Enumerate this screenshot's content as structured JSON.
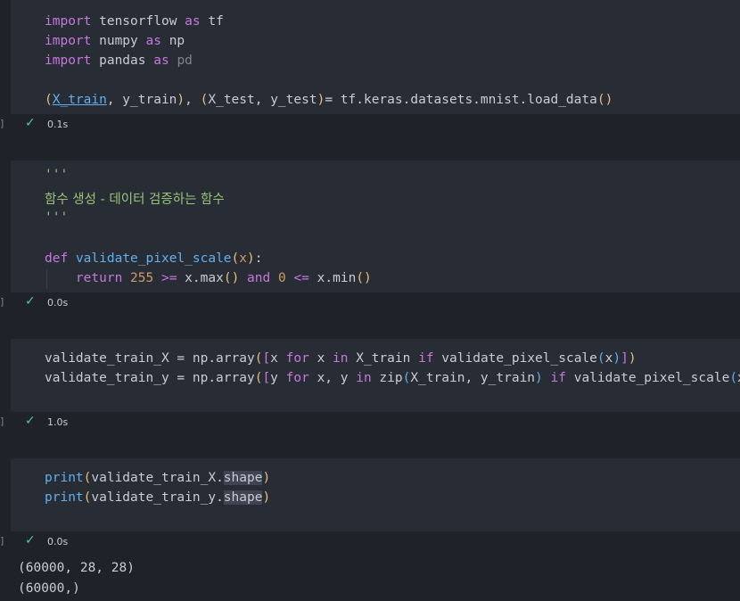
{
  "cells": [
    {
      "lines": [
        "import tensorflow as tf",
        "import numpy as np",
        "import pandas as pd",
        "",
        "(X_train, y_train), (X_test, y_test)= tf.keras.datasets.mnist.load_data()"
      ],
      "time": "0.1s"
    },
    {
      "lines": [
        "'''",
        "함수 생성 - 데이터 검증하는 함수",
        "'''",
        "",
        "def validate_pixel_scale(x):",
        "    return 255 >= x.max() and 0 <= x.min()"
      ],
      "time": "0.0s"
    },
    {
      "lines": [
        "validate_train_X = np.array([x for x in X_train if validate_pixel_scale(x)])",
        "validate_train_y = np.array([y for x, y in zip(X_train, y_train) if validate_pixel_scale(x)])"
      ],
      "time": "1.0s"
    },
    {
      "lines": [
        "print(validate_train_X.shape)",
        "print(validate_train_y.shape)"
      ],
      "time": "0.0s"
    }
  ],
  "output": [
    "(60000, 28, 28)",
    "(60000,)"
  ],
  "colors": {
    "background": "#1f2329",
    "cell": "#282c34",
    "keyword": "#c678dd",
    "function": "#61afef",
    "number": "#d19a66",
    "string": "#98c379",
    "success": "#4ec994"
  },
  "icons": {
    "status": "check-icon"
  }
}
